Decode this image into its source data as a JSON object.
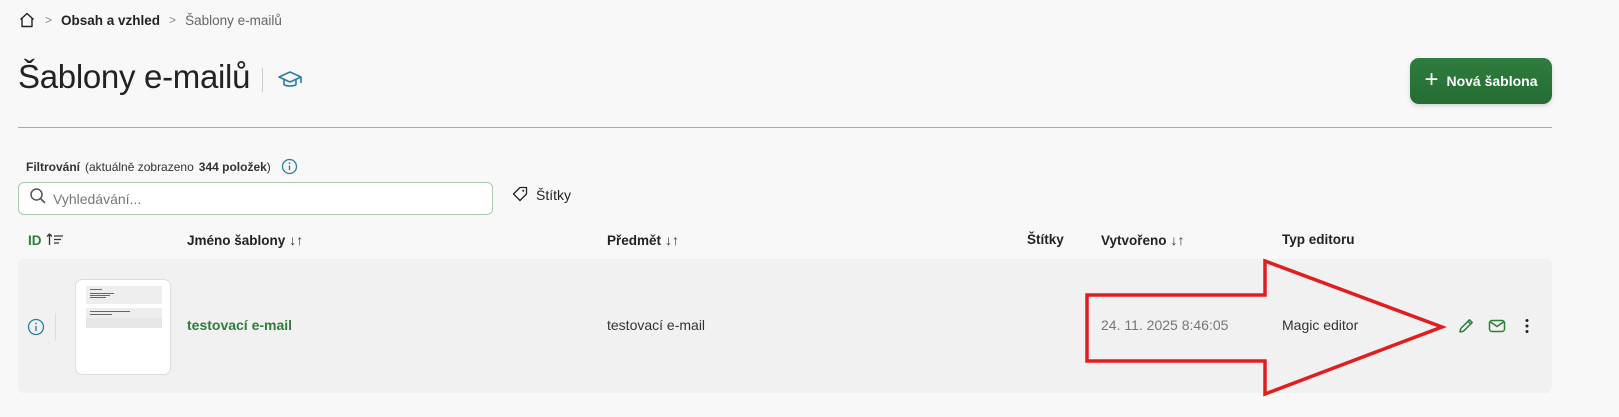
{
  "breadcrumb": {
    "parent": "Obsah a vzhled",
    "current": "Šablony e-mailů"
  },
  "page": {
    "title": "Šablony e-mailů"
  },
  "toolbar": {
    "new_template_label": "Nová šablona"
  },
  "filter": {
    "label": "Filtrování",
    "count_prefix": "(aktuálně zobrazeno",
    "count_value": "344 položek",
    "count_suffix": ")",
    "search_placeholder": "Vyhledávání...",
    "tags_label": "Štítky"
  },
  "table": {
    "headers": {
      "id": "ID",
      "name": "Jméno šablony",
      "subject": "Předmět",
      "tags": "Štítky",
      "created": "Vytvořeno",
      "editor": "Typ editoru"
    },
    "rows": [
      {
        "name": "testovací e-mail",
        "subject": "testovací e-mail",
        "tags": "",
        "created": "24. 11. 2025 8:46:05",
        "editor": "Magic editor"
      }
    ]
  },
  "colors": {
    "accent": "#2e7d3a",
    "button": "#27703a",
    "annotation": "#e11d1d"
  },
  "icons": [
    "home-icon",
    "graduation-cap-icon",
    "plus-icon",
    "info-icon",
    "search-icon",
    "tag-icon",
    "sort-icon",
    "edit-icon",
    "mail-icon",
    "more-vertical-icon"
  ]
}
